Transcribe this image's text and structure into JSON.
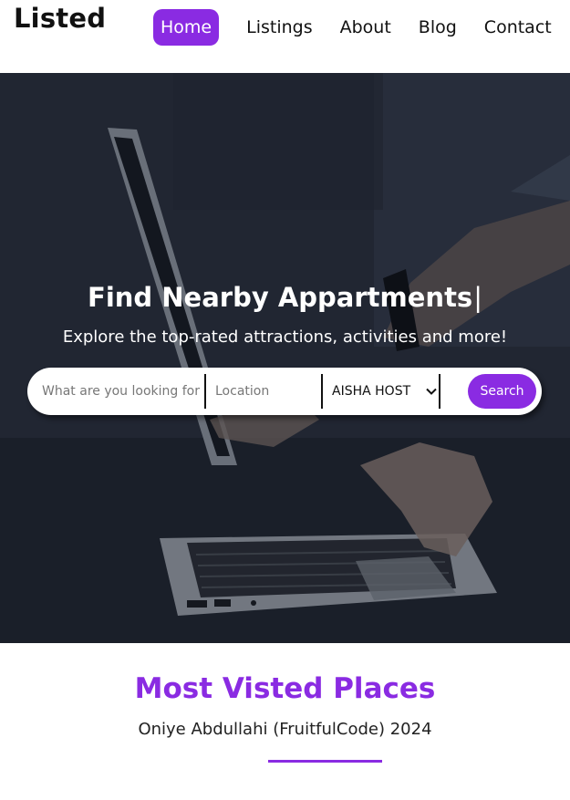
{
  "header": {
    "logo": "Listed",
    "nav": [
      "Home",
      "Listings",
      "About",
      "Blog",
      "Contact"
    ],
    "active_item": "Home"
  },
  "hero": {
    "title": "Find Nearby Appartments",
    "cursor": "|",
    "subtitle": "Explore the top-rated attractions, activities and more!"
  },
  "search": {
    "what_placeholder": "What are you looking for ?",
    "location_placeholder": "Location",
    "host_selected": "AISHA HOST",
    "button_label": "Search"
  },
  "section": {
    "title": "Most Visted Places",
    "subtitle": "Oniye Abdullahi (FruitfulCode) 2024"
  },
  "colors": {
    "accent": "#8a2be2",
    "hero_overlay": "#1c212b",
    "text_dark": "#111111"
  },
  "icons": {
    "host_select": "chevron-down-icon"
  }
}
